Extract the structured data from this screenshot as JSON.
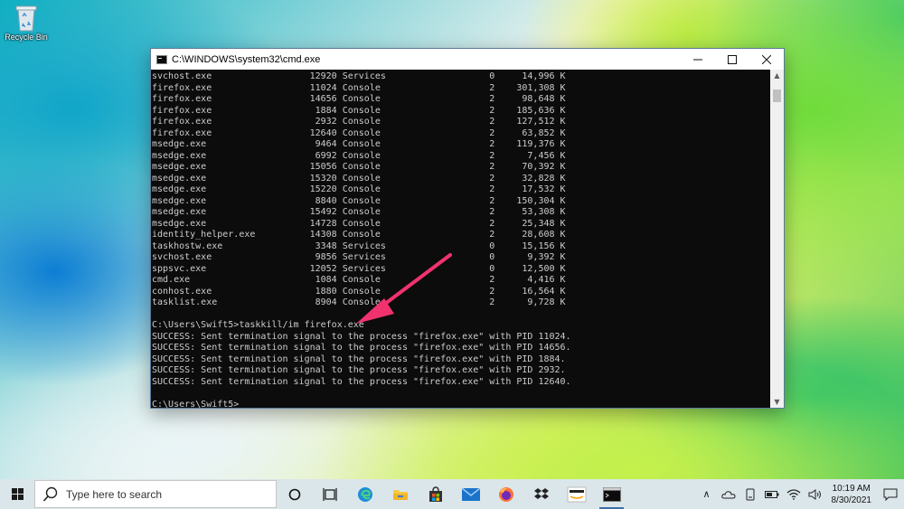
{
  "desktop": {
    "recycle_bin_label": "Recycle Bin"
  },
  "window": {
    "title": "C:\\WINDOWS\\system32\\cmd.exe",
    "minimize_label": "—",
    "maximize_label": "☐",
    "close_label": "✕"
  },
  "console": {
    "lines": [
      "svchost.exe                  12920 Services                   0     14,996 K",
      "firefox.exe                  11024 Console                    2    301,308 K",
      "firefox.exe                  14656 Console                    2     98,648 K",
      "firefox.exe                   1884 Console                    2    185,636 K",
      "firefox.exe                   2932 Console                    2    127,512 K",
      "firefox.exe                  12640 Console                    2     63,852 K",
      "msedge.exe                    9464 Console                    2    119,376 K",
      "msedge.exe                    6992 Console                    2      7,456 K",
      "msedge.exe                   15056 Console                    2     70,392 K",
      "msedge.exe                   15320 Console                    2     32,828 K",
      "msedge.exe                   15220 Console                    2     17,532 K",
      "msedge.exe                    8840 Console                    2    150,304 K",
      "msedge.exe                   15492 Console                    2     53,308 K",
      "msedge.exe                   14728 Console                    2     25,348 K",
      "identity_helper.exe          14308 Console                    2     28,608 K",
      "taskhostw.exe                 3348 Services                   0     15,156 K",
      "svchost.exe                   9856 Services                   0      9,392 K",
      "sppsvc.exe                   12052 Services                   0     12,500 K",
      "cmd.exe                       1084 Console                    2      4,416 K",
      "conhost.exe                   1880 Console                    2     16,564 K",
      "tasklist.exe                  8904 Console                    2      9,728 K",
      "",
      "C:\\Users\\Swift5>taskkill/im firefox.exe",
      "SUCCESS: Sent termination signal to the process \"firefox.exe\" with PID 11024.",
      "SUCCESS: Sent termination signal to the process \"firefox.exe\" with PID 14656.",
      "SUCCESS: Sent termination signal to the process \"firefox.exe\" with PID 1884.",
      "SUCCESS: Sent termination signal to the process \"firefox.exe\" with PID 2932.",
      "SUCCESS: Sent termination signal to the process \"firefox.exe\" with PID 12640.",
      "",
      "C:\\Users\\Swift5>"
    ],
    "text_color": "#cccccc",
    "background": "#0c0c0c"
  },
  "scrollbar": {
    "up_arrow": "▲",
    "down_arrow": "▼"
  },
  "annotation": {
    "arrow_color": "#f0336e"
  },
  "taskbar": {
    "search_placeholder": "Type here to search",
    "icons": [
      "cortana-icon",
      "task-view-icon",
      "edge-icon",
      "file-explorer-icon",
      "store-icon",
      "mail-icon",
      "firefox-icon",
      "dropbox-icon",
      "amazon-icon",
      "cmd-icon"
    ],
    "tray": {
      "chevron": "∧",
      "time": "10:19 AM",
      "date": "8/30/2021"
    }
  }
}
